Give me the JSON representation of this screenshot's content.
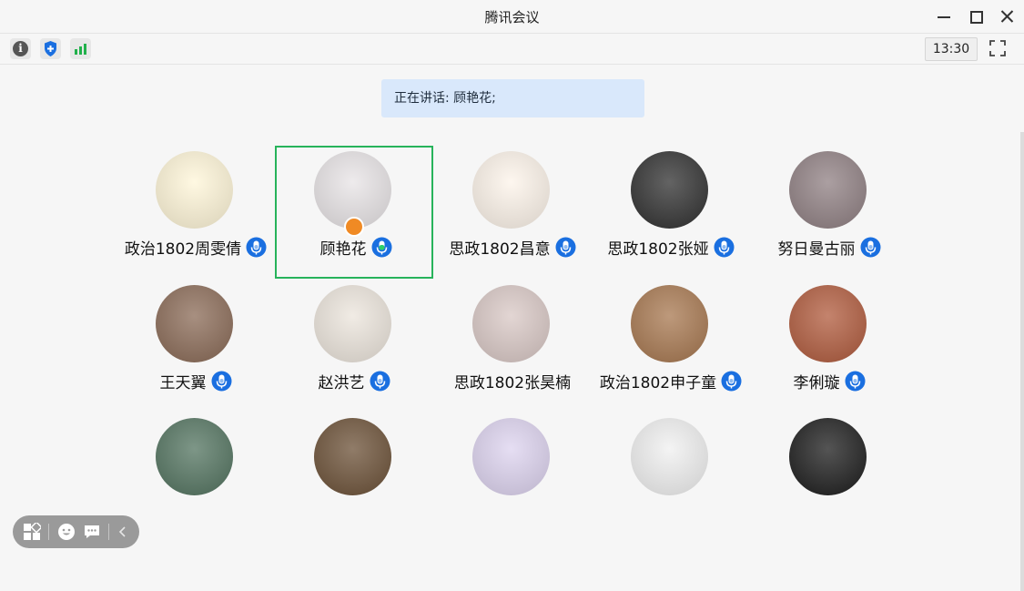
{
  "window": {
    "title": "腾讯会议",
    "clock": "13:30"
  },
  "icons": {
    "toolbar": [
      "info-icon",
      "security-shield-icon",
      "signal-strength-icon"
    ],
    "window_controls": [
      "minimize-icon",
      "maximize-icon",
      "close-icon"
    ],
    "fullscreen": "fullscreen-icon",
    "floating": [
      "layout-icon",
      "emoji-icon",
      "chat-icon",
      "collapse-chevron-icon"
    ]
  },
  "colors": {
    "accent_blue": "#1a6fe0",
    "active_green": "#27b35b",
    "speaking_bg": "#d9e8fb",
    "host_badge": "#f08a24"
  },
  "speaking": {
    "label": "正在讲话: 顾艳花;"
  },
  "participants": [
    {
      "name": "政治1802周雯倩",
      "mic": "muted",
      "active": false,
      "host": false,
      "avatar_bg": "#fff6d8"
    },
    {
      "name": "顾艳花",
      "mic": "speaking",
      "active": true,
      "host": true,
      "avatar_bg": "#e8e4e6"
    },
    {
      "name": "思政1802昌意",
      "mic": "muted",
      "active": false,
      "host": false,
      "avatar_bg": "#fdf4ea"
    },
    {
      "name": "思政1802张娅",
      "mic": "muted",
      "active": false,
      "host": false,
      "avatar_bg": "#2f2f2f"
    },
    {
      "name": "努日曼古丽",
      "mic": "muted",
      "active": false,
      "host": false,
      "avatar_bg": "#8f7f82"
    },
    {
      "name": "王天翼",
      "mic": "muted",
      "active": false,
      "host": false,
      "avatar_bg": "#8a6a56"
    },
    {
      "name": "赵洪艺",
      "mic": "muted",
      "active": false,
      "host": false,
      "avatar_bg": "#ece5dc"
    },
    {
      "name": "思政1802张昊楠",
      "mic": "none",
      "active": false,
      "host": false,
      "avatar_bg": "#d9c8c5"
    },
    {
      "name": "政治1802申子童",
      "mic": "muted",
      "active": false,
      "host": false,
      "avatar_bg": "#a7774f"
    },
    {
      "name": "李俐璇",
      "mic": "muted",
      "active": false,
      "host": false,
      "avatar_bg": "#b05a3c"
    },
    {
      "name": "",
      "mic": "none",
      "active": false,
      "host": false,
      "avatar_bg": "#52735f"
    },
    {
      "name": "",
      "mic": "none",
      "active": false,
      "host": false,
      "avatar_bg": "#6b5036"
    },
    {
      "name": "",
      "mic": "none",
      "active": false,
      "host": false,
      "avatar_bg": "#ddd3ef"
    },
    {
      "name": "",
      "mic": "none",
      "active": false,
      "host": false,
      "avatar_bg": "#f0f0f0"
    },
    {
      "name": "",
      "mic": "none",
      "active": false,
      "host": false,
      "avatar_bg": "#1b1b1b"
    }
  ]
}
